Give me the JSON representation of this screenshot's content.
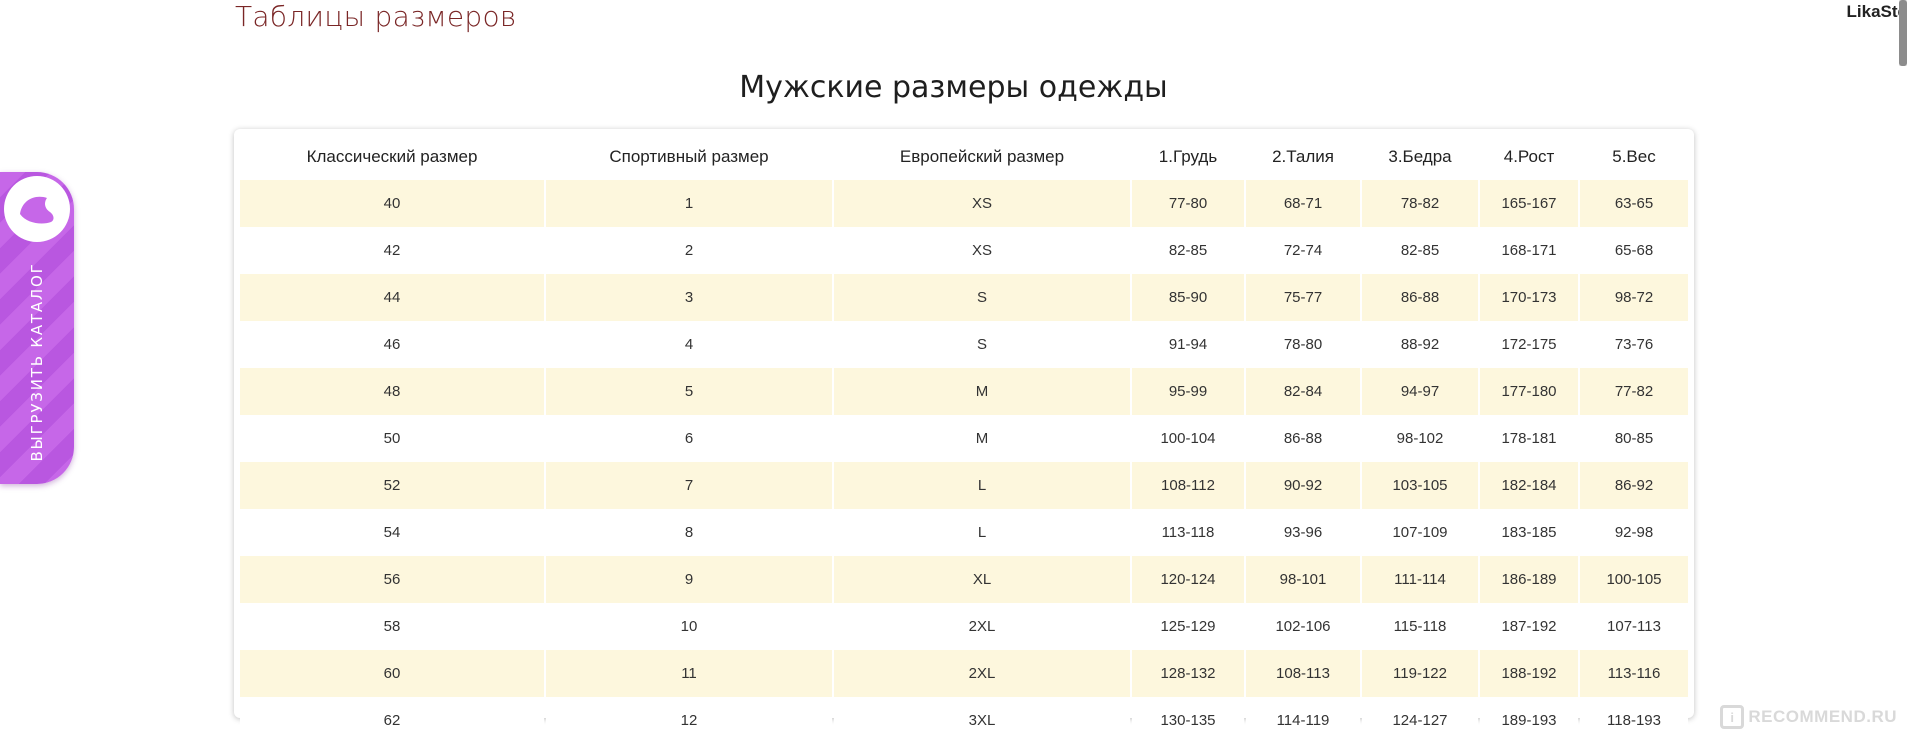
{
  "page": {
    "title": "Таблицы размеров",
    "username": "LikaSte",
    "section_title": "Мужские размеры одежды"
  },
  "side_widget": {
    "label": "ВЫГРУЗИТЬ КАТАЛОГ",
    "icon": "leaf-logo-icon",
    "color": "#c667e8"
  },
  "table": {
    "headers": [
      "Классический размер",
      "Спортивный размер",
      "Европейский размер",
      "1.Грудь",
      "2.Талия",
      "3.Бедра",
      "4.Рост",
      "5.Вес"
    ],
    "rows": [
      [
        "40",
        "1",
        "XS",
        "77-80",
        "68-71",
        "78-82",
        "165-167",
        "63-65"
      ],
      [
        "42",
        "2",
        "XS",
        "82-85",
        "72-74",
        "82-85",
        "168-171",
        "65-68"
      ],
      [
        "44",
        "3",
        "S",
        "85-90",
        "75-77",
        "86-88",
        "170-173",
        "98-72"
      ],
      [
        "46",
        "4",
        "S",
        "91-94",
        "78-80",
        "88-92",
        "172-175",
        "73-76"
      ],
      [
        "48",
        "5",
        "M",
        "95-99",
        "82-84",
        "94-97",
        "177-180",
        "77-82"
      ],
      [
        "50",
        "6",
        "M",
        "100-104",
        "86-88",
        "98-102",
        "178-181",
        "80-85"
      ],
      [
        "52",
        "7",
        "L",
        "108-112",
        "90-92",
        "103-105",
        "182-184",
        "86-92"
      ],
      [
        "54",
        "8",
        "L",
        "113-118",
        "93-96",
        "107-109",
        "183-185",
        "92-98"
      ],
      [
        "56",
        "9",
        "XL",
        "120-124",
        "98-101",
        "111-114",
        "186-189",
        "100-105"
      ],
      [
        "58",
        "10",
        "2XL",
        "125-129",
        "102-106",
        "115-118",
        "187-192",
        "107-113"
      ],
      [
        "60",
        "11",
        "2XL",
        "128-132",
        "108-113",
        "119-122",
        "188-192",
        "113-116"
      ],
      [
        "62",
        "12",
        "3XL",
        "130-135",
        "114-119",
        "124-127",
        "189-193",
        "118-193"
      ]
    ],
    "stripe_color": "#fdf7dd"
  },
  "watermark": {
    "badge": "i",
    "text": "RECOMMEND.RU"
  }
}
